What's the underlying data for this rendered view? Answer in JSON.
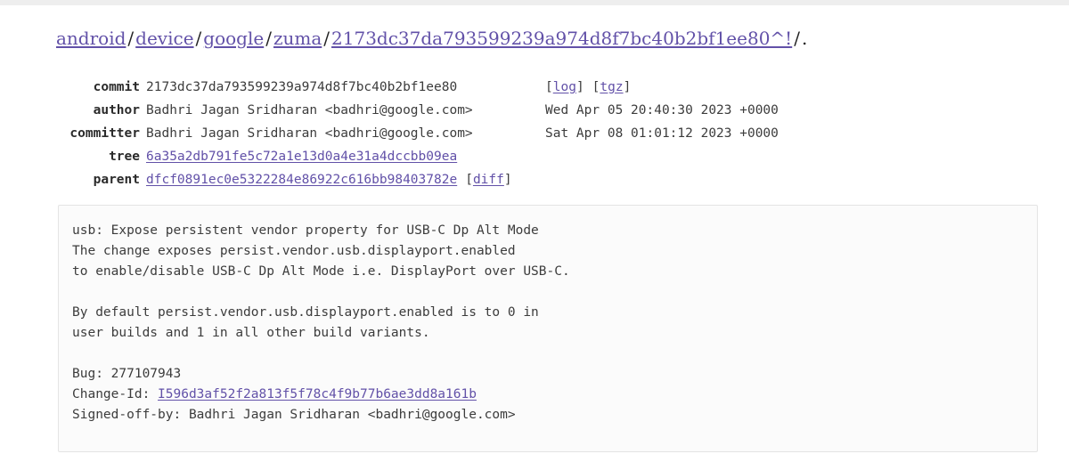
{
  "colors": {
    "link": "#6251a8",
    "text": "#3c3c3c",
    "label": "#2b2b2b",
    "box_bg": "#fbfbfb",
    "box_border": "#e4e4e4",
    "top_band": "#eeeeee",
    "page_bg": "#ffffff"
  },
  "breadcrumb": {
    "items": [
      {
        "label": "android",
        "link": true
      },
      {
        "label": "device",
        "link": true
      },
      {
        "label": "google",
        "link": true
      },
      {
        "label": "zuma",
        "link": true
      },
      {
        "label": "2173dc37da793599239a974d8f7bc40b2bf1ee80^!",
        "link": true
      }
    ],
    "separator": "/",
    "trailing": "."
  },
  "meta": {
    "rows": [
      {
        "label": "commit",
        "value": "2173dc37da793599239a974d8f7bc40b2bf1ee80",
        "value_is_link": false,
        "extra_links": [
          {
            "label": "log"
          },
          {
            "label": "tgz"
          }
        ]
      },
      {
        "label": "author",
        "value": "Badhri Jagan Sridharan <badhri@google.com>",
        "value_is_link": false,
        "date": "Wed Apr 05 20:40:30 2023 +0000"
      },
      {
        "label": "committer",
        "value": "Badhri Jagan Sridharan <badhri@google.com>",
        "value_is_link": false,
        "date": "Sat Apr 08 01:01:12 2023 +0000"
      },
      {
        "label": "tree",
        "value": "6a35a2db791fe5c72a1e13d0a4e31a4dccbb09ea",
        "value_is_link": true
      },
      {
        "label": "parent",
        "value": "dfcf0891ec0e5322284e86922c616bb98403782e",
        "value_is_link": true,
        "diff_label": "diff"
      }
    ]
  },
  "commit_message": {
    "subject": "usb: Expose persistent vendor property for USB-C Dp Alt Mode",
    "body_before_change_id": "The change exposes persist.vendor.usb.displayport.enabled\nto enable/disable USB-C Dp Alt Mode i.e. DisplayPort over USB-C.\n\nBy default persist.vendor.usb.displayport.enabled is to 0 in\nuser builds and 1 in all other build variants.\n\nBug: 277107943\nChange-Id: ",
    "change_id": "I596d3af52f2a813f5f78c4f9b77b6ae3dd8a161b",
    "body_after_change_id": "\nSigned-off-by: Badhri Jagan Sridharan <badhri@google.com>"
  }
}
